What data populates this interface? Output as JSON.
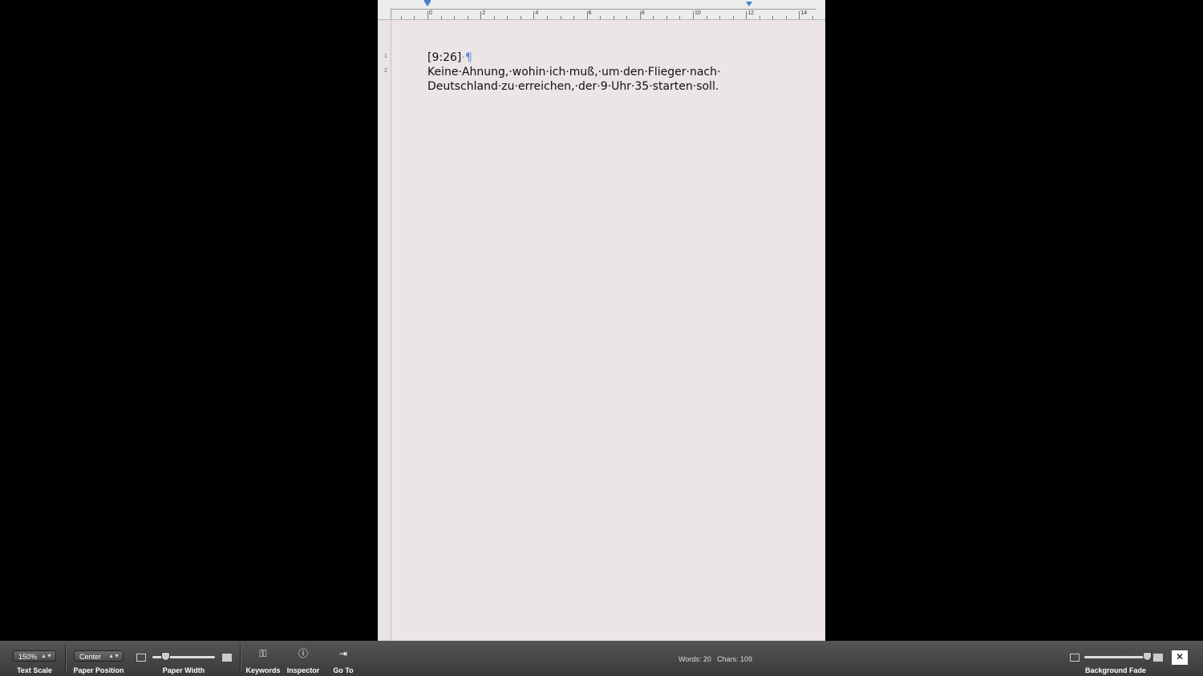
{
  "ruler": {
    "labels": [
      "0",
      "2",
      "4",
      "6",
      "8",
      "10",
      "12",
      "14"
    ]
  },
  "document": {
    "line_numbers": [
      "1",
      "2"
    ],
    "line1": "[9:26]",
    "pilcrow": "¶",
    "line2": "Keine·Ahnung,·wohin·ich·muß,·um·den·Flieger·nach·",
    "line3": "Deutschland·zu·erreichen,·der·9·Uhr·35·starten·soll."
  },
  "toolbar": {
    "text_scale": {
      "value": "150%",
      "label": "Text Scale"
    },
    "paper_position": {
      "value": "Center",
      "label": "Paper Position"
    },
    "paper_width": {
      "label": "Paper Width"
    },
    "keywords": {
      "label": "Keywords",
      "icon": "key-icon"
    },
    "inspector": {
      "label": "Inspector",
      "icon": "info-icon"
    },
    "goto": {
      "label": "Go To",
      "icon": "goto-icon"
    },
    "words": "Words: 20",
    "chars": "Chars: 109",
    "background_fade": {
      "label": "Background Fade"
    }
  }
}
